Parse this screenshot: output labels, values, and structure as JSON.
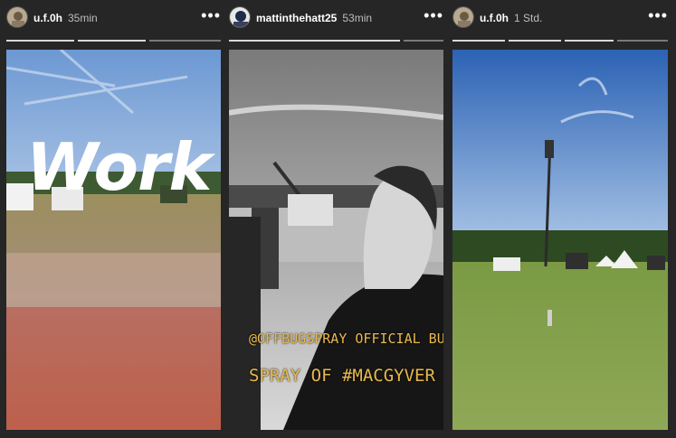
{
  "stories": [
    {
      "username": "u.f.0h",
      "time": "35min",
      "more": "•••",
      "overlay_text": "Work",
      "avatar": "avatar-photo"
    },
    {
      "username": "mattinthehatt25",
      "time": "53min",
      "more": "•••",
      "caption_line1": "@OFFBUGSPRAY OFFICIAL BUG",
      "caption_line2": "SPRAY OF #MACGYVER",
      "avatar": "avatar-photo"
    },
    {
      "username": "u.f.0h",
      "time": "1 Std.",
      "more": "•••",
      "avatar": "avatar-photo"
    }
  ],
  "colors": {
    "background": "#262626",
    "caption": "#e9b84d",
    "progress_seen": "#d8d8d8",
    "progress_unseen": "#7a7a7a"
  }
}
